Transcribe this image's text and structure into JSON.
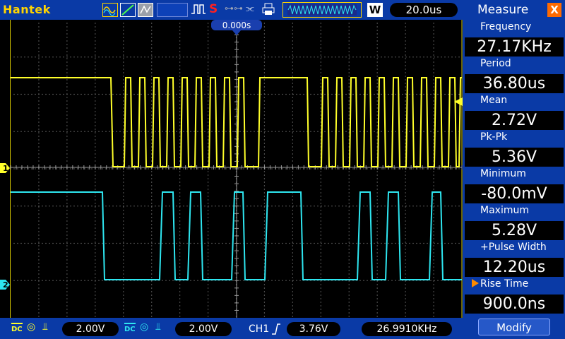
{
  "toolbar": {
    "brand": "Hantek",
    "mode_letter": "W",
    "timebase": "20.0us",
    "trigger_position": "0.000s",
    "icons": [
      "wave-mode-icon",
      "line-mode-icon",
      "persist-icon",
      "run-pulse-icon",
      "stop-icon",
      "key-icon",
      "usb-icon",
      "print-icon",
      "memory-waveform-icon"
    ]
  },
  "bottom": {
    "ch1_coupling": "DC",
    "ch1_scale": "2.00V",
    "ch2_coupling": "DC",
    "ch2_scale": "2.00V",
    "trigger_source": "CH1",
    "trigger_level": "3.76V",
    "trigger_frequency": "26.9910KHz"
  },
  "channels": [
    {
      "marker": "1",
      "color": "#ffff2a"
    },
    {
      "marker": "2",
      "color": "#2ee6f0"
    }
  ],
  "measure": {
    "title": "Measure",
    "close_label": "X",
    "items": [
      {
        "label": "Frequency",
        "value": "27.17KHz"
      },
      {
        "label": "Period",
        "value": "36.80us"
      },
      {
        "label": "Mean",
        "value": "2.72V"
      },
      {
        "label": "Pk-Pk",
        "value": "5.36V"
      },
      {
        "label": "Minimum",
        "value": "-80.0mV"
      },
      {
        "label": "Maximum",
        "value": "5.28V"
      },
      {
        "label": "+Pulse Width",
        "value": "12.20us"
      },
      {
        "label": "Rise Time",
        "value": "900.0ns"
      }
    ],
    "modify_label": "Modify"
  },
  "colors": {
    "panel": "#0a3aa6",
    "ch1": "#ffff2a",
    "ch2": "#2ee6f0",
    "accent": "#ffd400"
  }
}
